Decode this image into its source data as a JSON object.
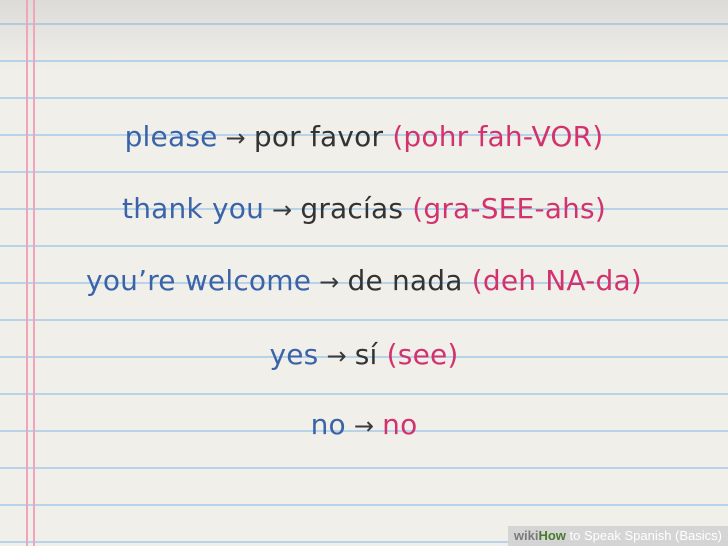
{
  "phrases": [
    {
      "english": "please",
      "arrow": "→",
      "spanish": "por favor",
      "pronunciation": "(pohr fah-VOR)"
    },
    {
      "english": "thank you",
      "arrow": "→",
      "spanish": "gracías",
      "pronunciation": "(gra-SEE-ahs)"
    },
    {
      "english": "you’re welcome",
      "arrow": "→",
      "spanish": "de nada",
      "pronunciation": "(deh NA-da)"
    },
    {
      "english": "yes",
      "arrow": "→",
      "spanish": "sí",
      "pronunciation": "(see)"
    },
    {
      "english": "no",
      "arrow": "→",
      "spanish": "",
      "pronunciation": "no"
    }
  ],
  "watermark": {
    "wiki": "wiki",
    "how": "How",
    "title": " to Speak Spanish (Basics)"
  },
  "colors": {
    "english": "#3b64a8",
    "spanish": "#333333",
    "pronunciation": "#d2326e",
    "ruled_line": "#b7d3ea",
    "margin_line": "#f0a6b8",
    "paper": "#f1efea"
  }
}
